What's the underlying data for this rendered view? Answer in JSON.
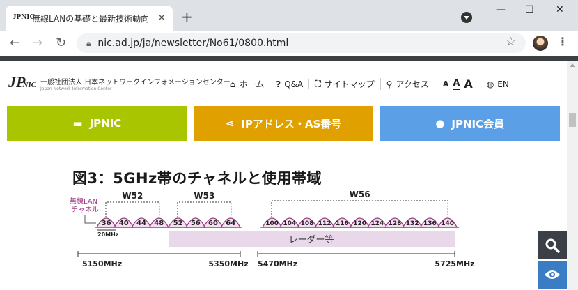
{
  "browser": {
    "tab_title": "無線LANの基礎と最新技術動向 - JPNIC",
    "tab_favicon": "JPNIC",
    "new_tab": "+",
    "close_tab": "✕",
    "url": "nic.ad.jp/ja/newsletter/No61/0800.html",
    "minimize": "—",
    "maximize": "☐",
    "close": "✕"
  },
  "site": {
    "logo_mark": "JP",
    "logo_mark_small": "NIC",
    "logo_jp": "一般社団法人 日本ネットワークインフォメーションセンター",
    "logo_en": "Japan Network Information Center",
    "nav": {
      "home": "ホーム",
      "qa": "Q&A",
      "sitemap": "サイトマップ",
      "access": "アクセス",
      "font_small": "A",
      "font_medium": "A",
      "font_large": "A",
      "lang": "EN"
    },
    "buttons": [
      {
        "label": "JPNIC",
        "color": "#a8c500",
        "icon": "box-icon"
      },
      {
        "label": "IPアドレス・AS番号",
        "color": "#e0a000",
        "icon": "share-icon"
      },
      {
        "label": "JPNIC会員",
        "color": "#5b9fe6",
        "icon": "user-icon"
      }
    ]
  },
  "figure": {
    "title": "図3：5GHz帯のチャネルと使用帯域",
    "lan_label_1": "無線LAN",
    "lan_label_2": "チャネル",
    "bandwidth_label": "20MHz",
    "radar_label": "レーダー等",
    "groups": [
      {
        "name": "W52",
        "channels": [
          "36",
          "40",
          "44",
          "48"
        ]
      },
      {
        "name": "W53",
        "channels": [
          "52",
          "56",
          "60",
          "64"
        ]
      },
      {
        "name": "W56",
        "channels": [
          "100",
          "104",
          "108",
          "112",
          "116",
          "120",
          "124",
          "128",
          "132",
          "136",
          "140"
        ]
      }
    ],
    "freq_labels": [
      "5150MHz",
      "5350MHz",
      "5470MHz",
      "5725MHz"
    ],
    "accent_color": "#9b3a86",
    "radar_color": "#e8d8ea"
  },
  "fab": {
    "search_color": "#3a4046",
    "view_color": "#3b7dc4"
  }
}
